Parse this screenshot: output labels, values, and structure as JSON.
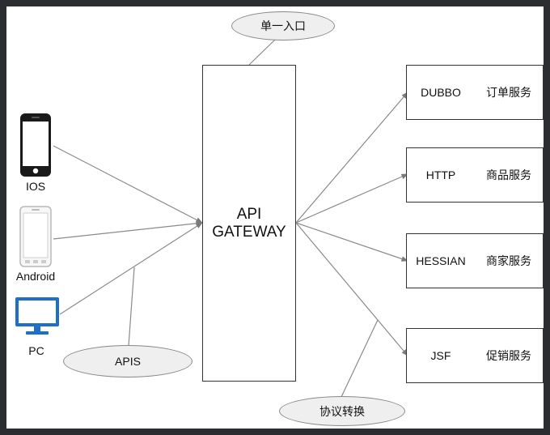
{
  "gateway": {
    "line1": "API",
    "line2": "GATEWAY"
  },
  "bubbles": {
    "entry": "单一入口",
    "apis": "APIS",
    "protocol": "协议转换"
  },
  "clients": [
    {
      "label": "IOS",
      "icon": "iphone-icon"
    },
    {
      "label": "Android",
      "icon": "android-phone-icon"
    },
    {
      "label": "PC",
      "icon": "desktop-monitor-icon"
    }
  ],
  "services": [
    {
      "protocol": "DUBBO",
      "name": "订单服务"
    },
    {
      "protocol": "HTTP",
      "name": "商品服务"
    },
    {
      "protocol": "HESSIAN",
      "name": "商家服务"
    },
    {
      "protocol": "JSF",
      "name": "促销服务"
    }
  ],
  "colors": {
    "line": "#8a8a8a",
    "monitor": "#1f6fc6",
    "bubble": "#efefef"
  }
}
